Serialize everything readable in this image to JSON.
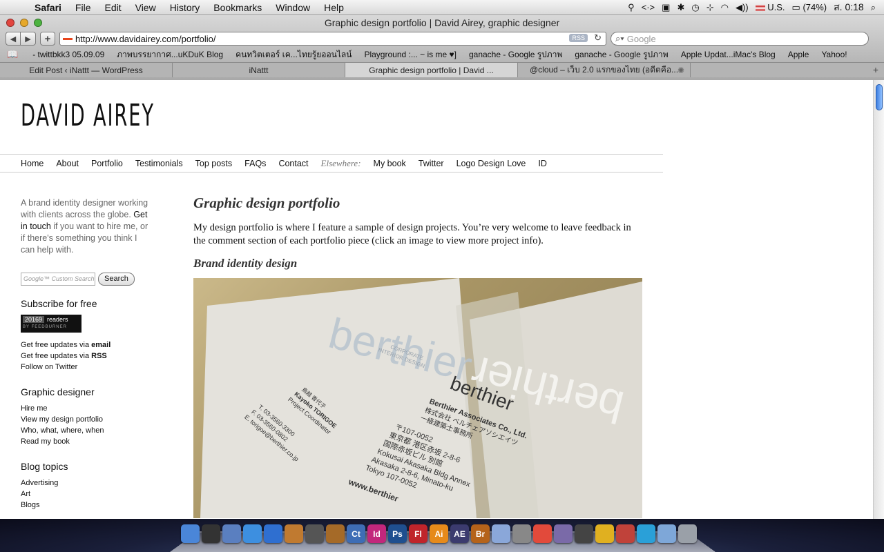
{
  "menubar": {
    "app": "Safari",
    "items": [
      "File",
      "Edit",
      "View",
      "History",
      "Bookmarks",
      "Window",
      "Help"
    ],
    "input_source": "U.S.",
    "battery": "(74%)",
    "clock": "ส. 0:18"
  },
  "window": {
    "title": "Graphic design portfolio | David Airey, graphic designer",
    "url": "http://www.davidairey.com/portfolio/",
    "rss_label": "RSS",
    "search_placeholder": "Google"
  },
  "bookmarks": [
    "- twittbkk3 05.09.09",
    "ภาพบรรยากาศ...uKDuK Blog",
    "คนทวิตเตอร์ เค...ไทยรู้ยออนไลน์",
    "Playground :... ~ is me ♥]",
    "ganache - Google รูปภาพ",
    "ganache - Google รูปภาพ",
    "Apple Updat...iMac's Blog",
    "Apple",
    "Yahoo!"
  ],
  "tabs": [
    {
      "label": "Edit Post ‹ iNattt — WordPress"
    },
    {
      "label": "iNattt"
    },
    {
      "label": "Graphic design portfolio | David ..."
    },
    {
      "label": "@cloud – เว็บ 2.0 แรกของไทย (อดีตคือ..."
    }
  ],
  "site": {
    "title": "DAVID AIREY",
    "nav": [
      "Home",
      "About",
      "Portfolio",
      "Testimonials",
      "Top posts",
      "FAQs",
      "Contact"
    ],
    "elsewhere_label": "Elsewhere:",
    "nav_external": [
      "My book",
      "Twitter",
      "Logo Design Love",
      "ID"
    ]
  },
  "sidebar": {
    "intro_a": "A brand identity designer working with clients across the globe. ",
    "intro_link": "Get in touch",
    "intro_b": " if you want to hire me, or if there's something you think I can help with.",
    "search_placeholder": "Google™ Custom Search",
    "search_button": "Search",
    "subscribe_heading": "Subscribe for free",
    "feed_count": "20169",
    "feed_readers": "readers",
    "feed_by": "BY FEEDBURNER",
    "updates_email_prefix": "Get free updates via ",
    "updates_email": "email",
    "updates_rss_prefix": "Get free updates via ",
    "updates_rss": "RSS",
    "follow_twitter": "Follow on Twitter",
    "designer_heading": "Graphic designer",
    "designer_links": [
      "Hire me",
      "View my design portfolio",
      "Who, what, where, when",
      "Read my book"
    ],
    "topics_heading": "Blog topics",
    "topics": [
      "Advertising",
      "Art",
      "Blogs"
    ]
  },
  "main": {
    "title": "Graphic design portfolio",
    "intro": "My design portfolio is where I feature a sample of design projects. You’re very welcome to leave feedback in the comment section of each portfolio piece (click an image to view more project info).",
    "section": "Brand identity design",
    "photo": {
      "watermark": "berthier",
      "brand": "berthier",
      "company": "Berthier Associates Co., Ltd.",
      "company_jp": "株式会社 ベルチェアソシエイツ",
      "company_jp2": "一級建築士事務所",
      "postal": "〒107-0052",
      "addr_jp1": "東京都 港区赤坂 2-8-6",
      "addr_jp2": "国際赤坂ビル 別館",
      "addr1": "Kokusai Akasaka Bldg Annex",
      "addr2": "Akasaka 2-8-6, Minato-ku",
      "addr3": "Tokyo 107-0052",
      "web": "www.berthier",
      "name_jp": "鳥越 香代子",
      "name": "Kayoko TORIGOE",
      "role": "Project Coordinator",
      "tel": "T. 03-3560-3300",
      "fax": "F. 03-3560-0802",
      "email": "E. torigoe@berthier.co.jp",
      "corp_label": "CORPORATE",
      "corp_label2": "INTERIOR DESIGN"
    }
  },
  "dock": {
    "icons": [
      {
        "name": "finder-icon",
        "label": "",
        "color": "#4a86d8"
      },
      {
        "name": "dashboard-icon",
        "label": "",
        "color": "#333"
      },
      {
        "name": "mail-icon",
        "label": "",
        "color": "#5a7fc0"
      },
      {
        "name": "safari-icon",
        "label": "",
        "color": "#3d8fe0"
      },
      {
        "name": "itunes-icon",
        "label": "",
        "color": "#2f6fd0"
      },
      {
        "name": "iphoto-icon",
        "label": "",
        "color": "#c07a30"
      },
      {
        "name": "star-icon",
        "label": "",
        "color": "#555"
      },
      {
        "name": "garageband-icon",
        "label": "",
        "color": "#a56a28"
      },
      {
        "name": "contribute-icon",
        "label": "Ct",
        "color": "#3e6db5"
      },
      {
        "name": "indesign-icon",
        "label": "Id",
        "color": "#c2277c"
      },
      {
        "name": "photoshop-icon",
        "label": "Ps",
        "color": "#1f4f8f"
      },
      {
        "name": "flash-icon",
        "label": "Fl",
        "color": "#c0242b"
      },
      {
        "name": "illustrator-icon",
        "label": "Ai",
        "color": "#e68a1a"
      },
      {
        "name": "aftereffects-icon",
        "label": "AE",
        "color": "#3b3b6e"
      },
      {
        "name": "bridge-icon",
        "label": "Br",
        "color": "#b5631a"
      },
      {
        "name": "preview-icon",
        "label": "",
        "color": "#8aa7d9"
      },
      {
        "name": "sysprefs-icon",
        "label": "",
        "color": "#888"
      },
      {
        "name": "chrome-icon",
        "label": "",
        "color": "#e24a3b"
      },
      {
        "name": "brush-icon",
        "label": "",
        "color": "#7a6aa8"
      },
      {
        "name": "typewriter-icon",
        "label": "",
        "color": "#444"
      },
      {
        "name": "adium-icon",
        "label": "",
        "color": "#e0b020"
      },
      {
        "name": "pencil-icon",
        "label": "",
        "color": "#c0423a"
      },
      {
        "name": "bird-icon",
        "label": "",
        "color": "#2aa0d8"
      },
      {
        "name": "folder-icon",
        "label": "",
        "color": "#7ea7d8"
      },
      {
        "name": "trash-icon",
        "label": "",
        "color": "#9aa0a8"
      }
    ]
  }
}
